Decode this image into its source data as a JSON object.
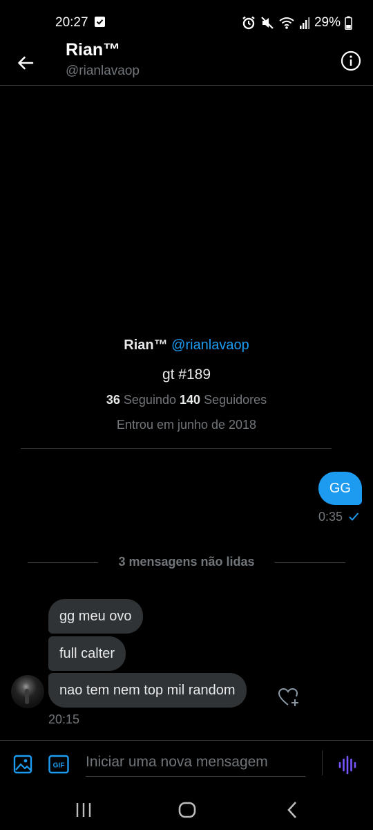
{
  "status_bar": {
    "time": "20:27",
    "battery_percent": "29%",
    "icons": [
      "check-notification-icon",
      "alarm-icon",
      "mute-icon",
      "wifi-icon",
      "signal-icon",
      "battery-icon"
    ]
  },
  "header": {
    "name": "Rian™",
    "handle": "@rianlavaop",
    "icons": [
      "back-arrow-icon",
      "info-icon"
    ]
  },
  "profile": {
    "name": "Rian™",
    "handle": "@rianlavaop",
    "bio": "gt #189",
    "following_count": "36",
    "following_label": "Seguindo",
    "followers_count": "140",
    "followers_label": "Seguidores",
    "joined": "Entrou em junho de 2018"
  },
  "conversation": {
    "sent": [
      {
        "text": "GG",
        "time": "0:35",
        "status_icon": "read-check-icon"
      }
    ],
    "unread_label": "3 mensagens não lidas",
    "received": [
      {
        "text": "gg meu ovo"
      },
      {
        "text": "full calter"
      },
      {
        "text": "nao tem nem top mil random"
      }
    ],
    "received_time": "20:15",
    "reaction_icon": "heart-plus-icon"
  },
  "composer": {
    "placeholder": "Iniciar uma nova mensagem",
    "value": "",
    "icons": [
      "image-icon",
      "gif-icon",
      "voice-wave-icon"
    ]
  },
  "navigation": {
    "icons": [
      "recent-apps-icon",
      "home-icon",
      "nav-back-icon"
    ]
  },
  "colors": {
    "background": "#000000",
    "accent": "#1d9bf0",
    "received_bubble": "#2f3336",
    "secondary_text": "#71767b",
    "voice_icon": "#7856ff"
  }
}
